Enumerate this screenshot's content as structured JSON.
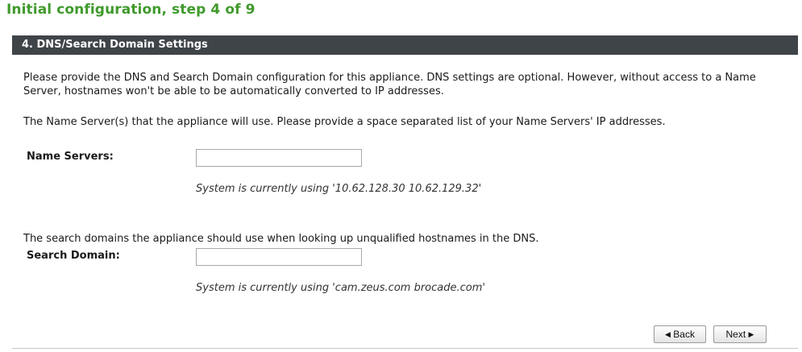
{
  "page": {
    "title": "Initial configuration, step 4 of 9"
  },
  "panel": {
    "header": "4. DNS/Search Domain Settings",
    "intro": "Please provide the DNS and Search Domain configuration for this appliance. DNS settings are optional. However, without access to a Name Server, hostnames won't be able to be automatically converted to IP addresses.",
    "name_servers": {
      "description": "The Name Server(s) that the appliance will use. Please provide a space separated list of your Name Servers' IP addresses.",
      "label": "Name Servers:",
      "value": "",
      "hint": "System is currently using '10.62.128.30 10.62.129.32'"
    },
    "search_domain": {
      "description": "The search domains the appliance should use when looking up unqualified hostnames in the DNS.",
      "label": "Search Domain:",
      "value": "",
      "hint": "System is currently using 'cam.zeus.com brocade.com'"
    }
  },
  "buttons": {
    "back": "Back",
    "next": "Next",
    "back_icon": "left-triangle",
    "next_icon": "right-triangle"
  }
}
